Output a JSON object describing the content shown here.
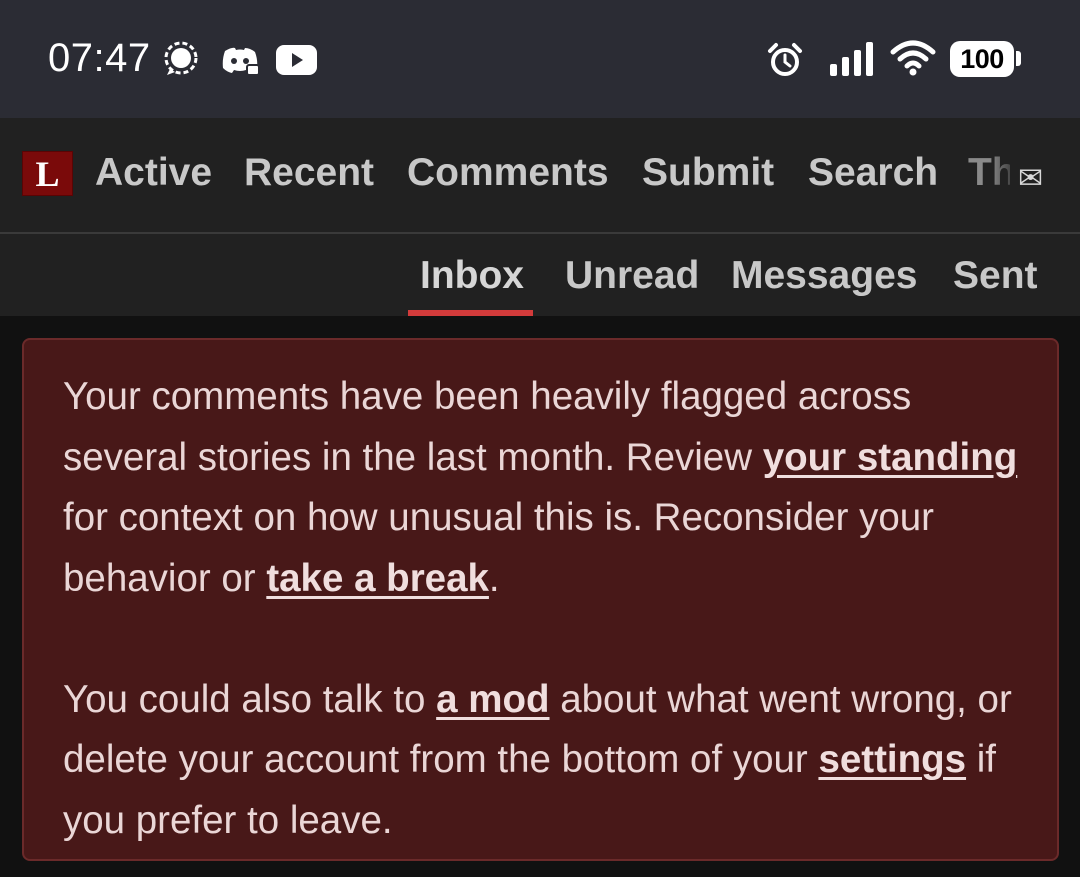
{
  "status_bar": {
    "time": "07:47",
    "notification_icons": [
      "signal-messenger-icon",
      "discord-icon",
      "youtube-icon"
    ],
    "system_icons": [
      "alarm-icon",
      "cell-signal-icon",
      "wifi-icon"
    ],
    "battery": "100"
  },
  "nav": {
    "logo": "L",
    "links": [
      "Active",
      "Recent",
      "Comments",
      "Submit",
      "Search",
      "Th"
    ],
    "envelope_icon": "✉"
  },
  "subnav": {
    "tabs": [
      "Inbox",
      "Unread",
      "Messages",
      "Sent"
    ],
    "active_tab": "Inbox"
  },
  "notice": {
    "p1_a": "Your comments have been heavily flagged across several stories in the last month. Review ",
    "p1_link1": "your standing",
    "p1_b": " for context on how unusual this is. Reconsider your behavior or ",
    "p1_link2": "take a break",
    "p1_c": ".",
    "p2_a": "You could also talk to ",
    "p2_link1": "a mod",
    "p2_b": " about what went wrong, or delete your account from the bottom of your ",
    "p2_link2": "settings",
    "p2_c": " if you prefer to leave."
  },
  "colors": {
    "status_bar_bg": "#2b2c34",
    "nav_bg": "#212121",
    "page_bg": "#111111",
    "logo_red": "#7a0a0a",
    "active_underline": "#d33b3b",
    "notice_bg": "#481818",
    "notice_text": "#ead6d6"
  }
}
